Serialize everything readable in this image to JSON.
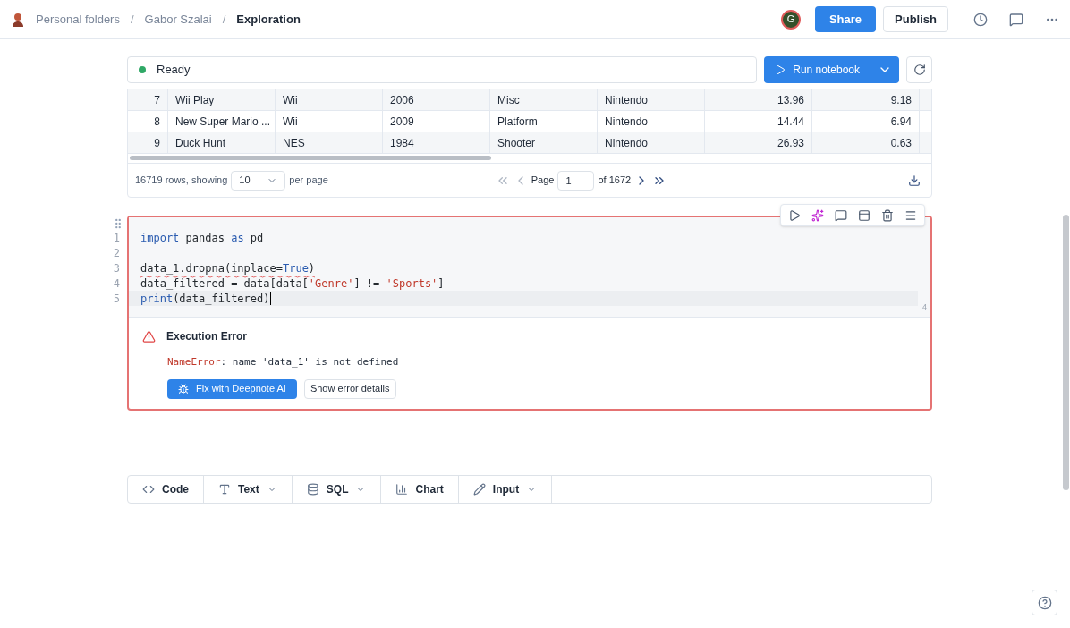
{
  "breadcrumbs": [
    {
      "label": "Personal folders",
      "current": false
    },
    {
      "label": "Gabor Szalai",
      "current": false
    },
    {
      "label": "Exploration",
      "current": true
    }
  ],
  "breadcrumb_separators": [
    "/",
    "/"
  ],
  "header": {
    "avatar": "G",
    "share": "Share",
    "publish": "Publish"
  },
  "status": {
    "label": "Ready",
    "color": "#2fa866"
  },
  "run_button": "Run notebook",
  "table": {
    "rows": [
      {
        "index": "7",
        "cells": [
          "Wii Play",
          "Wii",
          "2006",
          "Misc",
          "Nintendo",
          "13.96",
          "9.18"
        ],
        "selected": false
      },
      {
        "index": "8",
        "cells": [
          "New Super Mario ...",
          "Wii",
          "2009",
          "Platform",
          "Nintendo",
          "14.44",
          "6.94"
        ],
        "selected": false
      },
      {
        "index": "9",
        "cells": [
          "Duck Hunt",
          "NES",
          "1984",
          "Shooter",
          "Nintendo",
          "26.93",
          "0.63"
        ],
        "selected": false
      }
    ],
    "footer": {
      "rows_text": "16719 rows, showing",
      "page_size": "10",
      "per_page": "per page",
      "page_label": "Page",
      "page": "1",
      "of_pages": "of 1672"
    }
  },
  "code_cell": {
    "lines": [
      {
        "number": "1",
        "active": false,
        "flagged": false,
        "tokens": [
          {
            "text": "import",
            "kind": "keyword"
          },
          {
            "text": " pandas ",
            "kind": "plain"
          },
          {
            "text": "as",
            "kind": "keyword"
          },
          {
            "text": " pd",
            "kind": "plain"
          }
        ]
      },
      {
        "number": "2",
        "active": false
      },
      {
        "number": "3",
        "active": false,
        "flagged": true,
        "tokens": [
          {
            "text": "data_1.dropna(inplace=",
            "kind": "plain"
          },
          {
            "text": "True",
            "kind": "keyword"
          },
          {
            "text": ")",
            "kind": "plain"
          }
        ]
      },
      {
        "number": "4",
        "active": false,
        "flagged": false,
        "tokens": [
          {
            "text": "data_filtered = data[data[",
            "kind": "plain"
          },
          {
            "text": "'Genre'",
            "kind": "string"
          },
          {
            "text": "] != ",
            "kind": "plain"
          },
          {
            "text": "'Sports'",
            "kind": "string"
          },
          {
            "text": "]",
            "kind": "plain"
          }
        ]
      },
      {
        "number": "5",
        "active": true,
        "flagged": false,
        "tokens": [
          {
            "text": "print",
            "kind": "keyword"
          },
          {
            "text": "(data_filtered)",
            "kind": "plain"
          }
        ]
      }
    ],
    "corner_label": "4",
    "error": {
      "title": "Execution Error",
      "type": "NameError",
      "message": ": name 'data_1' is not defined",
      "fix_button": "Fix with Deepnote AI",
      "details_button": "Show error details"
    }
  },
  "add_blocks": [
    {
      "label": "Code",
      "dropdown": false
    },
    {
      "label": "Text",
      "dropdown": true
    },
    {
      "label": "SQL",
      "dropdown": true
    },
    {
      "label": "Chart",
      "dropdown": false
    },
    {
      "label": "Input",
      "dropdown": true
    }
  ]
}
